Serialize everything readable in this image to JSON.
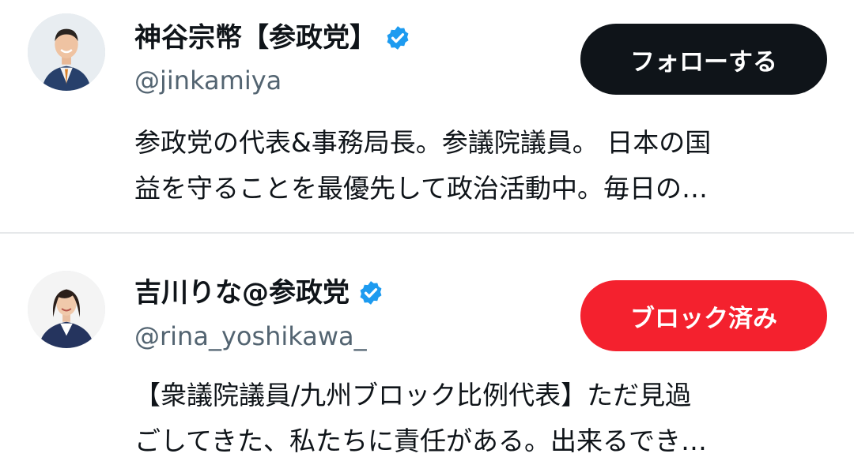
{
  "users": [
    {
      "display_name": "神谷宗幣【参政党】",
      "handle": "@jinkamiya",
      "action_label": "フォローする",
      "action_state": "follow",
      "verified": true,
      "bio_lines": [
        "参政党の代表&事務局長。参議院議員。 日本の国",
        "益を守ることを最優先して政治活動中。毎日の…"
      ]
    },
    {
      "display_name": "吉川りな@参政党",
      "handle": "@rina_yoshikawa_",
      "action_label": "ブロック済み",
      "action_state": "blocked",
      "verified": true,
      "bio_lines": [
        "【衆議院議員/九州ブロック比例代表】ただ見過",
        "ごしてきた、私たちに責任がある。出来るでき…"
      ]
    }
  ],
  "colors": {
    "follow_button": "#0f1419",
    "blocked_button": "#f4212e",
    "verified_badge": "#1d9bf0",
    "handle_text": "#536471",
    "divider": "#e6e8ea"
  },
  "icons": {
    "verified": "verified-badge-icon"
  }
}
